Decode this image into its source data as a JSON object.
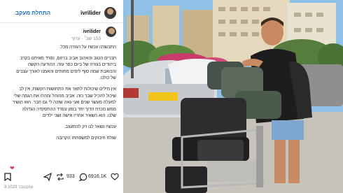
{
  "header": {
    "follow_label": "התחלת מעקב",
    "username": "ivrilider"
  },
  "comment": {
    "username": "ivrilider",
    "meta": "153 שב׳ · ערוך",
    "paragraphs": [
      "התבשרנו עכשיו על הגזרה מכל.",
      "חברים הטוב והאהוב אביב ברזום, נפרד מאיתנו בקרב ביהודים בגזרה של ביום כפר עזה. ההודעה הקשה והכואבת שמה סוף לימים מתוחים והאמנו לאורך עצבים של כולנו.",
      "אין מילים שיכולות לתאר את התחושות הקשות, אין לב שיכול להכיל שבר כזה. אביב מהוהל ומהלו את הגמה שלי למעלה מעשר שנים ואני גאה שזכה לי גם חבר. הוא הושיר ממש מכרח הדוך יחד בזמן ונפרד ההתפקדה הגדולה שלנו. הוא השאיר אחריו אישה ושני ילדים.",
      "עכשיו נשאר לנו רק להתעצב.",
      "שולח חיבוקים למשפחתו הקרובה"
    ]
  },
  "actions": {
    "likes": "16.1K",
    "comments": "69",
    "shares": "933"
  },
  "date": "9 אוקטובר 2023",
  "icons": {
    "follow": "avatar",
    "heart": "heart-icon",
    "comment": "comment-icon",
    "repost": "repost-icon",
    "share": "send-icon",
    "save": "bookmark-icon"
  },
  "colors": {
    "follow": "#1f6fd1",
    "heart": "#e23a4d"
  }
}
